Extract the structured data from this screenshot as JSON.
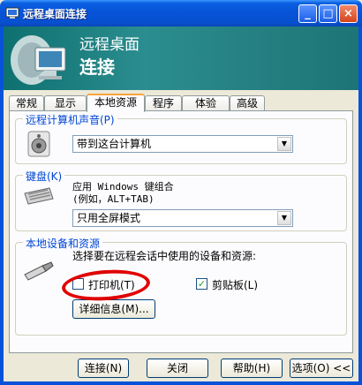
{
  "window": {
    "title": "远程桌面连接",
    "controls": {
      "minimize": "_",
      "maximize": "□",
      "close": "×"
    }
  },
  "banner": {
    "line1": "远程桌面",
    "line2": "连接"
  },
  "tabs": [
    "常规",
    "显示",
    "本地资源",
    "程序",
    "体验",
    "高级"
  ],
  "active_tab": "本地资源",
  "sound": {
    "title": "远程计算机声音(P)",
    "value": "带到这台计算机"
  },
  "keyboard": {
    "title": "键盘(K)",
    "desc1": "应用 Windows 键组合",
    "desc2": "(例如，ALT+TAB)",
    "value": "只用全屏模式"
  },
  "devices": {
    "title": "本地设备和资源",
    "desc": "选择要在远程会话中使用的设备和资源:",
    "printer_label": "打印机(T)",
    "printer_checked": false,
    "clipboard_label": "剪贴板(L)",
    "clipboard_checked": true,
    "details_button": "详细信息(M)..."
  },
  "footer": {
    "connect": "连接(N)",
    "close": "关闭",
    "help": "帮助(H)",
    "options": "选项(O) <<"
  }
}
